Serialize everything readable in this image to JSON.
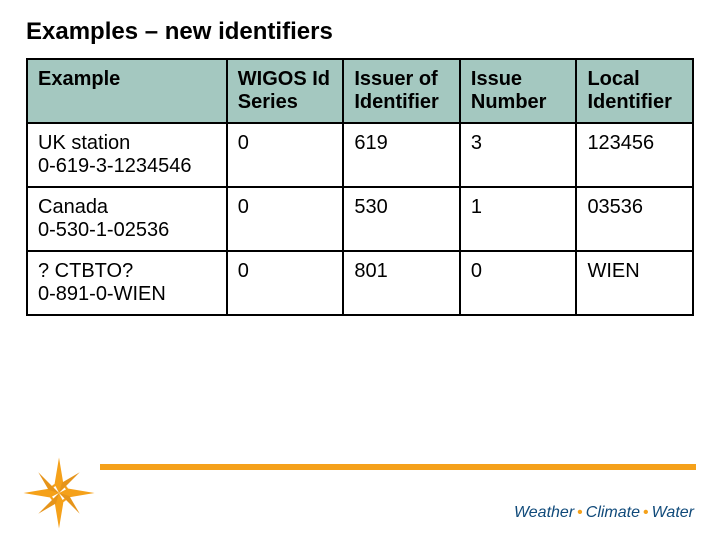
{
  "title": "Examples – new identifiers",
  "headers": {
    "example": "Example",
    "wigos": "WIGOS Id Series",
    "issuer": "Issuer of Identifier",
    "issue_num": "Issue Number",
    "local": "Local Identifier"
  },
  "rows": [
    {
      "label_line1": "UK station",
      "label_line2": "0-619-3-1234546",
      "wigos": "0",
      "issuer": "619",
      "issue_num": "3",
      "local": "123456"
    },
    {
      "label_line1": "Canada",
      "label_line2": "0-530-1-02536",
      "wigos": "0",
      "issuer": "530",
      "issue_num": "1",
      "local": "03536"
    },
    {
      "label_line1": "? CTBTO?",
      "label_line2": "0-891-0-WIEN",
      "wigos": "0",
      "issuer": "801",
      "issue_num": "0",
      "local": "WIEN"
    }
  ],
  "footer": {
    "w1": "Weather",
    "w2": "Climate",
    "w3": "Water"
  },
  "chart_data": {
    "type": "table",
    "title": "Examples – new identifiers",
    "columns": [
      "Example",
      "WIGOS Id Series",
      "Issuer of Identifier",
      "Issue Number",
      "Local Identifier"
    ],
    "rows": [
      [
        "UK station 0-619-3-1234546",
        0,
        619,
        3,
        "123456"
      ],
      [
        "Canada 0-530-1-02536",
        0,
        530,
        1,
        "03536"
      ],
      [
        "? CTBTO? 0-891-0-WIEN",
        0,
        801,
        0,
        "WIEN"
      ]
    ]
  }
}
